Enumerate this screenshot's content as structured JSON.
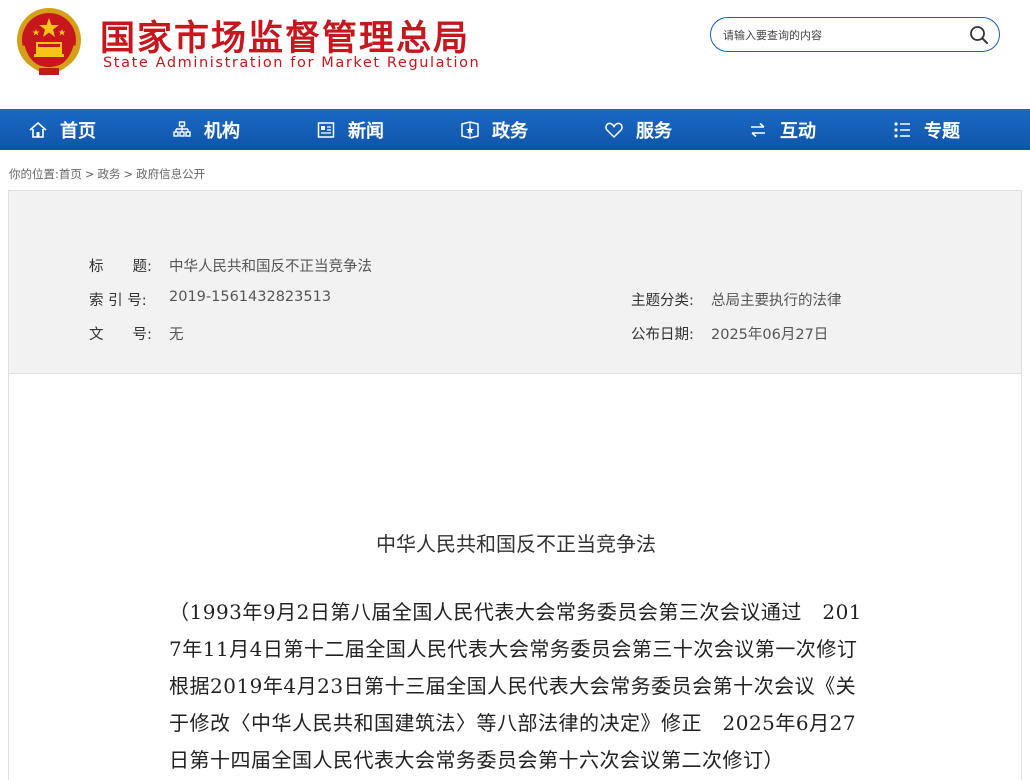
{
  "header": {
    "title": "国家市场监督管理总局",
    "subtitle": "State Administration for Market Regulation",
    "emblem_icon": "national-emblem-icon",
    "search": {
      "placeholder": "请输入要查询的内容",
      "value": ""
    }
  },
  "nav": {
    "items": [
      {
        "label": "首页",
        "icon": "home-icon"
      },
      {
        "label": "机构",
        "icon": "org-chart-icon"
      },
      {
        "label": "新闻",
        "icon": "newspaper-icon"
      },
      {
        "label": "政务",
        "icon": "gov-affairs-icon"
      },
      {
        "label": "服务",
        "icon": "heart-icon"
      },
      {
        "label": "互动",
        "icon": "exchange-arrows-icon"
      },
      {
        "label": "专题",
        "icon": "topic-list-icon"
      }
    ]
  },
  "breadcrumb": {
    "prefix": "你的位置:",
    "items": [
      "首页",
      "政务",
      "政府信息公开"
    ],
    "separator": ">"
  },
  "info": {
    "title_label": "标　　题:",
    "title_value": "中华人民共和国反不正当竞争法",
    "index_label": "索 引 号:",
    "index_value": "2019-1561432823513",
    "docno_label": "文　　号:",
    "docno_value": "无",
    "category_label": "主题分类:",
    "category_value": "总局主要执行的法律",
    "date_label": "公布日期:",
    "date_value": "2025年06月27日"
  },
  "document": {
    "title": "中华人民共和国反不正当竞争法",
    "revision_note": "（1993年9月2日第八届全国人民代表大会常务委员会第三次会议通过　2017年11月4日第十二届全国人民代表大会常务委员会第三十次会议第一次修订　根据2019年4月23日第十三届全国人民代表大会常务委员会第十次会议《关于修改〈中华人民共和国建筑法〉等八部法律的决定》修正　2025年6月27日第十四届全国人民代表大会常务委员会第十六次会议第二次修订）"
  },
  "colors": {
    "brand_red": "#c8161d",
    "nav_blue": "#1560b8",
    "panel_gray": "#f2f2f2"
  }
}
